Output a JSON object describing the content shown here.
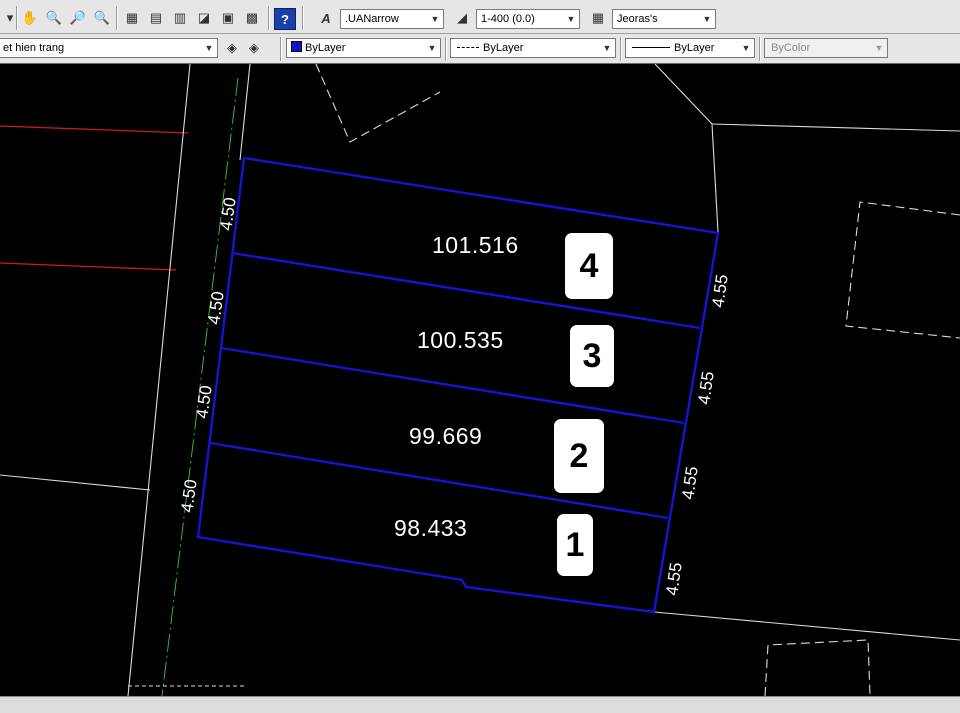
{
  "toolbar_top": {
    "text_style": {
      "value": ".UANarrow"
    },
    "dim_style": {
      "value": "1-400 (0.0)"
    },
    "table_style": {
      "value": "Jeoras's"
    }
  },
  "toolbar_props": {
    "layer": {
      "value": "et hien trang"
    },
    "color": {
      "value": "ByLayer",
      "swatch": "#1212c8"
    },
    "linetype": {
      "value": "ByLayer"
    },
    "lineweight": {
      "value": "ByLayer"
    },
    "plotstyle": {
      "value": "ByColor"
    }
  },
  "drawing": {
    "colors": {
      "lot_boundary": "#1414d2",
      "red_line": "#c81e1e",
      "white_line": "#e0e0e0",
      "green_line": "#3cc83c"
    },
    "lots": [
      {
        "number": "4",
        "area": "101.516"
      },
      {
        "number": "3",
        "area": "100.535"
      },
      {
        "number": "2",
        "area": "99.669"
      },
      {
        "number": "1",
        "area": "98.433"
      }
    ],
    "left_dims": [
      "4.50",
      "4.50",
      "4.50",
      "4.50"
    ],
    "right_dims": [
      "4.55",
      "4.55",
      "4.55",
      "4.55"
    ]
  }
}
